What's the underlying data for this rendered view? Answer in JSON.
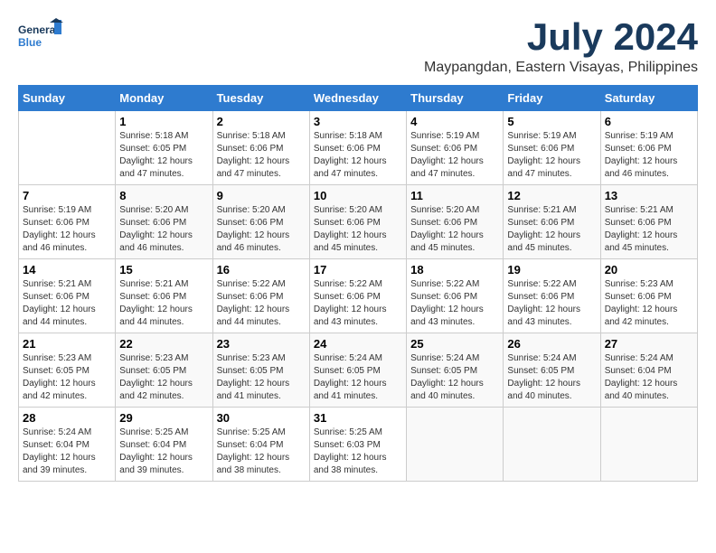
{
  "logo": {
    "line1": "General",
    "line2": "Blue"
  },
  "header": {
    "month_year": "July 2024",
    "location": "Maypangdan, Eastern Visayas, Philippines"
  },
  "days_of_week": [
    "Sunday",
    "Monday",
    "Tuesday",
    "Wednesday",
    "Thursday",
    "Friday",
    "Saturday"
  ],
  "weeks": [
    [
      {
        "day": "",
        "info": ""
      },
      {
        "day": "1",
        "info": "Sunrise: 5:18 AM\nSunset: 6:05 PM\nDaylight: 12 hours\nand 47 minutes."
      },
      {
        "day": "2",
        "info": "Sunrise: 5:18 AM\nSunset: 6:06 PM\nDaylight: 12 hours\nand 47 minutes."
      },
      {
        "day": "3",
        "info": "Sunrise: 5:18 AM\nSunset: 6:06 PM\nDaylight: 12 hours\nand 47 minutes."
      },
      {
        "day": "4",
        "info": "Sunrise: 5:19 AM\nSunset: 6:06 PM\nDaylight: 12 hours\nand 47 minutes."
      },
      {
        "day": "5",
        "info": "Sunrise: 5:19 AM\nSunset: 6:06 PM\nDaylight: 12 hours\nand 47 minutes."
      },
      {
        "day": "6",
        "info": "Sunrise: 5:19 AM\nSunset: 6:06 PM\nDaylight: 12 hours\nand 46 minutes."
      }
    ],
    [
      {
        "day": "7",
        "info": "Sunrise: 5:19 AM\nSunset: 6:06 PM\nDaylight: 12 hours\nand 46 minutes."
      },
      {
        "day": "8",
        "info": "Sunrise: 5:20 AM\nSunset: 6:06 PM\nDaylight: 12 hours\nand 46 minutes."
      },
      {
        "day": "9",
        "info": "Sunrise: 5:20 AM\nSunset: 6:06 PM\nDaylight: 12 hours\nand 46 minutes."
      },
      {
        "day": "10",
        "info": "Sunrise: 5:20 AM\nSunset: 6:06 PM\nDaylight: 12 hours\nand 45 minutes."
      },
      {
        "day": "11",
        "info": "Sunrise: 5:20 AM\nSunset: 6:06 PM\nDaylight: 12 hours\nand 45 minutes."
      },
      {
        "day": "12",
        "info": "Sunrise: 5:21 AM\nSunset: 6:06 PM\nDaylight: 12 hours\nand 45 minutes."
      },
      {
        "day": "13",
        "info": "Sunrise: 5:21 AM\nSunset: 6:06 PM\nDaylight: 12 hours\nand 45 minutes."
      }
    ],
    [
      {
        "day": "14",
        "info": "Sunrise: 5:21 AM\nSunset: 6:06 PM\nDaylight: 12 hours\nand 44 minutes."
      },
      {
        "day": "15",
        "info": "Sunrise: 5:21 AM\nSunset: 6:06 PM\nDaylight: 12 hours\nand 44 minutes."
      },
      {
        "day": "16",
        "info": "Sunrise: 5:22 AM\nSunset: 6:06 PM\nDaylight: 12 hours\nand 44 minutes."
      },
      {
        "day": "17",
        "info": "Sunrise: 5:22 AM\nSunset: 6:06 PM\nDaylight: 12 hours\nand 43 minutes."
      },
      {
        "day": "18",
        "info": "Sunrise: 5:22 AM\nSunset: 6:06 PM\nDaylight: 12 hours\nand 43 minutes."
      },
      {
        "day": "19",
        "info": "Sunrise: 5:22 AM\nSunset: 6:06 PM\nDaylight: 12 hours\nand 43 minutes."
      },
      {
        "day": "20",
        "info": "Sunrise: 5:23 AM\nSunset: 6:06 PM\nDaylight: 12 hours\nand 42 minutes."
      }
    ],
    [
      {
        "day": "21",
        "info": "Sunrise: 5:23 AM\nSunset: 6:05 PM\nDaylight: 12 hours\nand 42 minutes."
      },
      {
        "day": "22",
        "info": "Sunrise: 5:23 AM\nSunset: 6:05 PM\nDaylight: 12 hours\nand 42 minutes."
      },
      {
        "day": "23",
        "info": "Sunrise: 5:23 AM\nSunset: 6:05 PM\nDaylight: 12 hours\nand 41 minutes."
      },
      {
        "day": "24",
        "info": "Sunrise: 5:24 AM\nSunset: 6:05 PM\nDaylight: 12 hours\nand 41 minutes."
      },
      {
        "day": "25",
        "info": "Sunrise: 5:24 AM\nSunset: 6:05 PM\nDaylight: 12 hours\nand 40 minutes."
      },
      {
        "day": "26",
        "info": "Sunrise: 5:24 AM\nSunset: 6:05 PM\nDaylight: 12 hours\nand 40 minutes."
      },
      {
        "day": "27",
        "info": "Sunrise: 5:24 AM\nSunset: 6:04 PM\nDaylight: 12 hours\nand 40 minutes."
      }
    ],
    [
      {
        "day": "28",
        "info": "Sunrise: 5:24 AM\nSunset: 6:04 PM\nDaylight: 12 hours\nand 39 minutes."
      },
      {
        "day": "29",
        "info": "Sunrise: 5:25 AM\nSunset: 6:04 PM\nDaylight: 12 hours\nand 39 minutes."
      },
      {
        "day": "30",
        "info": "Sunrise: 5:25 AM\nSunset: 6:04 PM\nDaylight: 12 hours\nand 38 minutes."
      },
      {
        "day": "31",
        "info": "Sunrise: 5:25 AM\nSunset: 6:03 PM\nDaylight: 12 hours\nand 38 minutes."
      },
      {
        "day": "",
        "info": ""
      },
      {
        "day": "",
        "info": ""
      },
      {
        "day": "",
        "info": ""
      }
    ]
  ]
}
